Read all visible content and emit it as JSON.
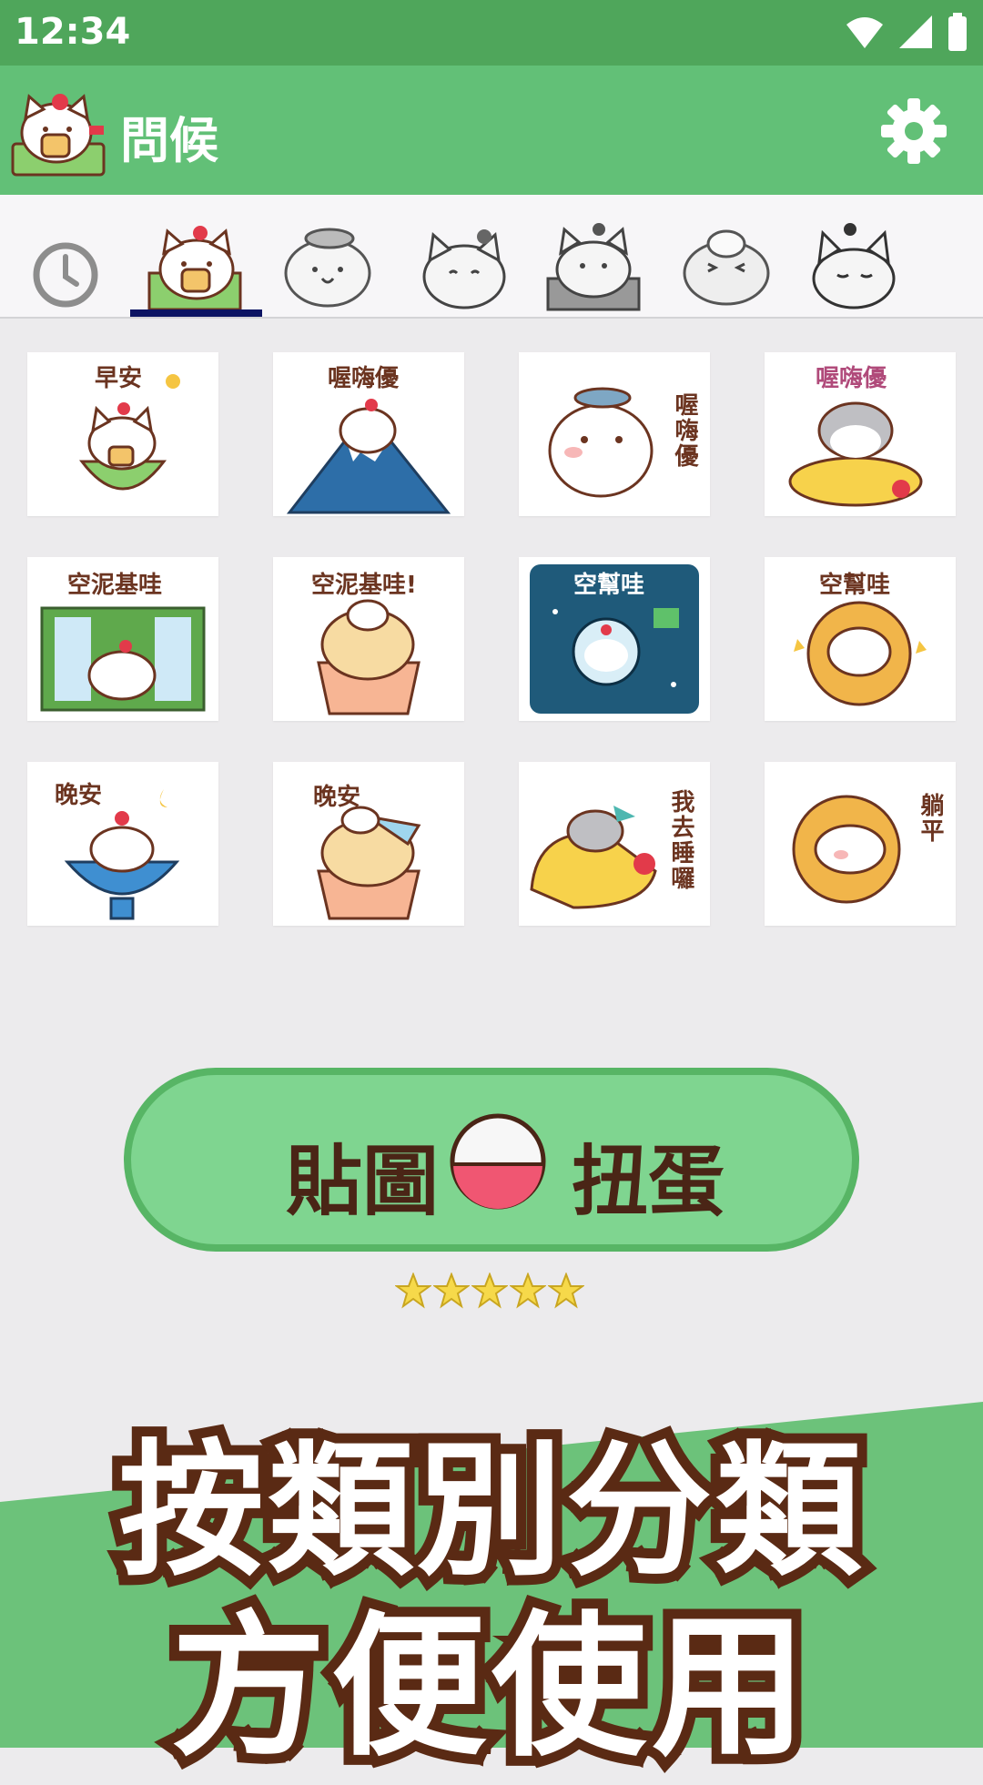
{
  "status_bar": {
    "time": "12:34"
  },
  "app_bar": {
    "title": "問候"
  },
  "tabs": [
    {
      "icon": "clock-icon"
    },
    {
      "icon": "cat-toast-icon"
    },
    {
      "icon": "hamster-hat-icon"
    },
    {
      "icon": "cat-cherry-icon"
    },
    {
      "icon": "cat-bowl-icon"
    },
    {
      "icon": "hamster-cream-icon"
    },
    {
      "icon": "cat-sleepy-icon"
    }
  ],
  "stickers": [
    {
      "text": "早安"
    },
    {
      "text": "喔嗨優"
    },
    {
      "text": "喔嗨優"
    },
    {
      "text": "喔嗨優"
    },
    {
      "text": "空泥基哇"
    },
    {
      "text": "空泥基哇!"
    },
    {
      "text": "空幫哇"
    },
    {
      "text": "空幫哇"
    },
    {
      "text": "晚安"
    },
    {
      "text": "晚安"
    },
    {
      "text": "我去睡囉"
    },
    {
      "text": "躺平"
    }
  ],
  "gacha": {
    "left_label": "貼圖",
    "right_label": "扭蛋",
    "stars": 5
  },
  "promo": {
    "line1": "按類別分類",
    "line2": "方便使用"
  },
  "colors": {
    "status_bar": "#4fa65b",
    "app_bar": "#62c077",
    "button": "#7fd590",
    "tab_indicator": "#0c1463",
    "text_brown": "#6b3420"
  }
}
